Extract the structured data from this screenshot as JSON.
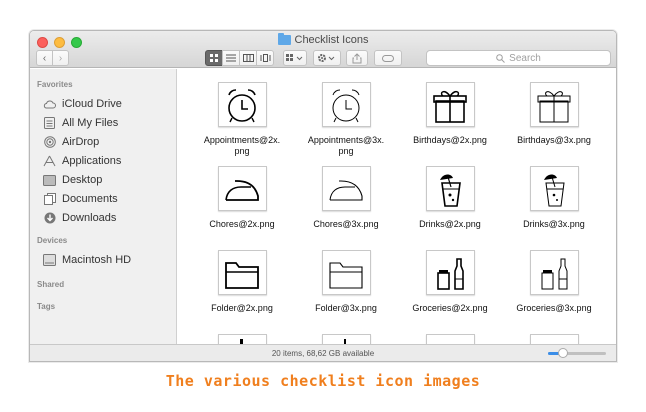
{
  "window": {
    "title": "Checklist Icons",
    "search_placeholder": "Search",
    "nav_back": "‹",
    "nav_forward": "›"
  },
  "sidebar": {
    "favorites_header": "Favorites",
    "favorites": [
      {
        "label": "iCloud Drive",
        "icon": "cloud-icon"
      },
      {
        "label": "All My Files",
        "icon": "all-files-icon"
      },
      {
        "label": "AirDrop",
        "icon": "airdrop-icon"
      },
      {
        "label": "Applications",
        "icon": "applications-icon"
      },
      {
        "label": "Desktop",
        "icon": "desktop-icon"
      },
      {
        "label": "Documents",
        "icon": "documents-icon"
      },
      {
        "label": "Downloads",
        "icon": "downloads-icon"
      }
    ],
    "devices_header": "Devices",
    "devices": [
      {
        "label": "Macintosh HD",
        "icon": "harddisk-icon"
      }
    ],
    "shared_header": "Shared",
    "tags_header": "Tags"
  },
  "files": [
    {
      "name": "Appointments@2x.\npng",
      "icon": "alarm-clock-icon"
    },
    {
      "name": "Appointments@3x.\npng",
      "icon": "alarm-clock-icon"
    },
    {
      "name": "Birthdays@2x.png",
      "icon": "gift-icon"
    },
    {
      "name": "Birthdays@3x.png",
      "icon": "gift-icon"
    },
    {
      "name": "Chores@2x.png",
      "icon": "iron-icon"
    },
    {
      "name": "Chores@3x.png",
      "icon": "iron-icon"
    },
    {
      "name": "Drinks@2x.png",
      "icon": "drink-icon"
    },
    {
      "name": "Drinks@3x.png",
      "icon": "drink-icon"
    },
    {
      "name": "Folder@2x.png",
      "icon": "folder-icon"
    },
    {
      "name": "Folder@3x.png",
      "icon": "folder-icon"
    },
    {
      "name": "Groceries@2x.png",
      "icon": "groceries-icon"
    },
    {
      "name": "Groceries@3x.png",
      "icon": "groceries-icon"
    }
  ],
  "status": {
    "text": "20 items, 68,62 GB available",
    "zoom_fraction": 0.25
  },
  "caption": "The various checklist icon images",
  "colors": {
    "caption": "#f07f1e",
    "accent": "#3b8ee8"
  }
}
